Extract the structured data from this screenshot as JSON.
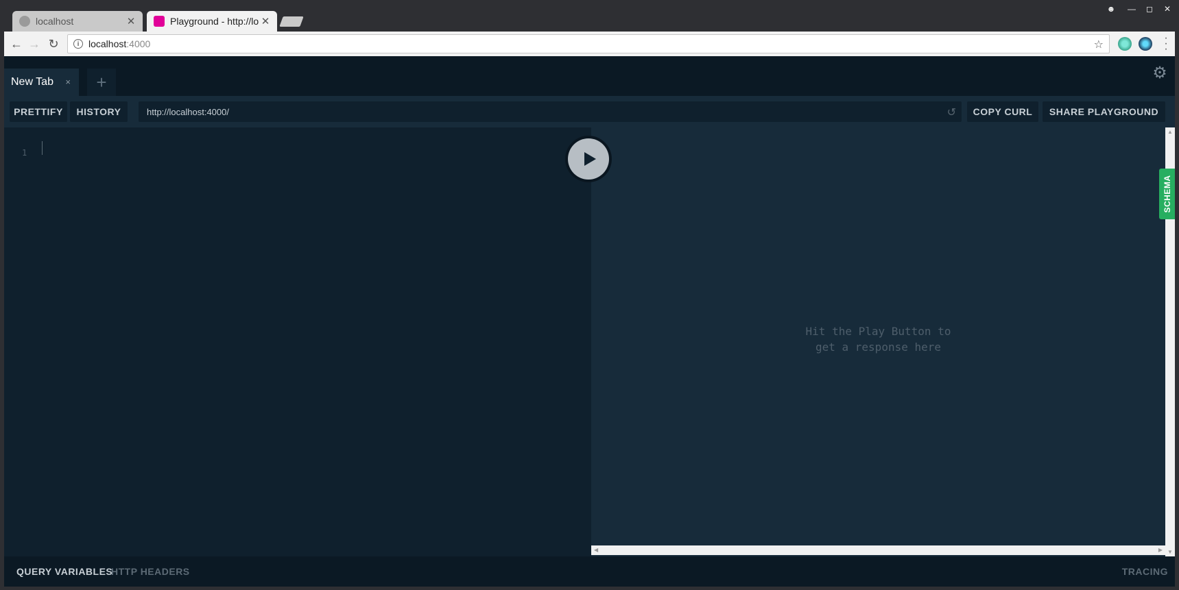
{
  "browser": {
    "tabs": [
      {
        "title": "localhost",
        "active": false
      },
      {
        "title": "Playground - http://lo",
        "active": true
      }
    ],
    "address": {
      "host": "localhost",
      "port": ":4000"
    }
  },
  "playground": {
    "tabs": [
      {
        "label": "New Tab",
        "close": "×"
      }
    ],
    "add_tab": "+",
    "toolbar": {
      "prettify": "PRETTIFY",
      "history": "HISTORY",
      "endpoint": "http://localhost:4000/",
      "copy_curl": "COPY CURL",
      "share": "SHARE PLAYGROUND"
    },
    "editor": {
      "line_number": "1"
    },
    "result": {
      "line1": "Hit the Play Button to",
      "line2": "get a response here"
    },
    "schema_tab": "SCHEMA",
    "bottom": {
      "query_variables": "QUERY VARIABLES",
      "http_headers": "HTTP HEADERS",
      "tracing": "TRACING"
    }
  },
  "colors": {
    "accent_green": "#27ae60",
    "graphql_pink": "#e10098",
    "editor_bg": "#0f202d",
    "result_bg": "#172b3a"
  }
}
